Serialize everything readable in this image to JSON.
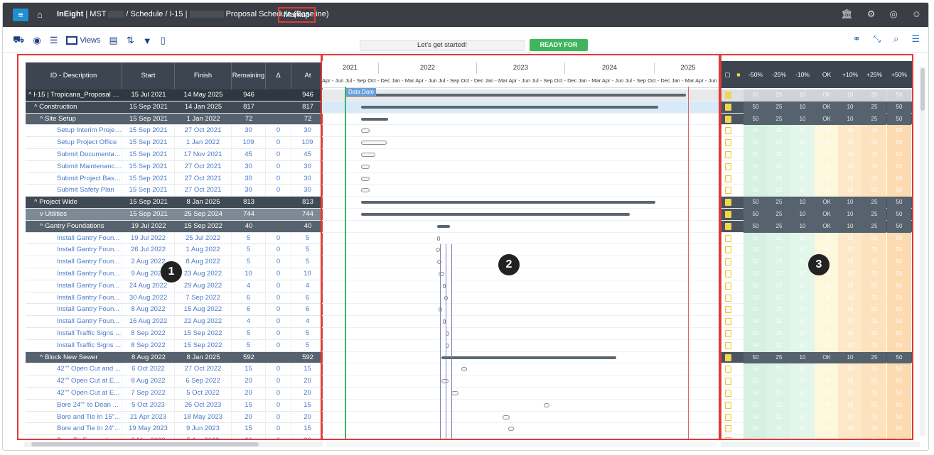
{
  "navbar": {
    "breadcrumb_app": "InEight",
    "breadcrumb_project": "MST",
    "breadcrumb_schedule": "Schedule",
    "breadcrumb_i15": "I-15",
    "breadcrumb_title": "Proposal Schedule (Baseline)",
    "markup_label": "Markup"
  },
  "toolbar": {
    "views_label": "Views",
    "lets_get_started": "Let's get started!",
    "ready_for_review": "READY FOR REVIEW?"
  },
  "grid": {
    "columns": [
      "ID - Description",
      "Start",
      "Finish",
      "Remaining ...",
      "Δ Rem...",
      "At Complet"
    ],
    "rows": [
      {
        "desc": "^ I-15 | Tropicana_Proposal Sch...",
        "start": "15 Jul 2021",
        "finish": "14 May 2025",
        "rem": "946",
        "drem": "",
        "atc": "946",
        "level": 0
      },
      {
        "desc": "^ Construction",
        "start": "15 Sep 2021",
        "finish": "14 Jan 2025",
        "rem": "817",
        "drem": "",
        "atc": "817",
        "level": 1
      },
      {
        "desc": "^ Site Setup",
        "start": "15 Sep 2021",
        "finish": "1 Jan 2022",
        "rem": "72",
        "drem": "",
        "atc": "72",
        "level": 2
      },
      {
        "desc": "Setup Interim Project ...",
        "start": "15 Sep 2021",
        "finish": "27 Oct 2021",
        "rem": "30",
        "drem": "0",
        "atc": "30",
        "level": 9
      },
      {
        "desc": "Setup Project Office",
        "start": "15 Sep 2021",
        "finish": "1 Jan 2022",
        "rem": "109",
        "drem": "0",
        "atc": "109",
        "level": 9
      },
      {
        "desc": "Submit Documentati...",
        "start": "15 Sep 2021",
        "finish": "17 Nov 2021",
        "rem": "45",
        "drem": "0",
        "atc": "45",
        "level": 9
      },
      {
        "desc": "Submit Maintenance ...",
        "start": "15 Sep 2021",
        "finish": "27 Oct 2021",
        "rem": "30",
        "drem": "0",
        "atc": "30",
        "level": 9
      },
      {
        "desc": "Submit Project Baseli...",
        "start": "15 Sep 2021",
        "finish": "27 Oct 2021",
        "rem": "30",
        "drem": "0",
        "atc": "30",
        "level": 9
      },
      {
        "desc": "Submit Safety Plan",
        "start": "15 Sep 2021",
        "finish": "27 Oct 2021",
        "rem": "30",
        "drem": "0",
        "atc": "30",
        "level": 9
      },
      {
        "desc": "^ Project Wide",
        "start": "15 Sep 2021",
        "finish": "8 Jan 2025",
        "rem": "813",
        "drem": "",
        "atc": "813",
        "level": 1
      },
      {
        "desc": "v Utilities",
        "start": "15 Sep 2021",
        "finish": "25 Sep 2024",
        "rem": "744",
        "drem": "",
        "atc": "744",
        "level": 3
      },
      {
        "desc": "^ Gantry Foundations",
        "start": "19 Jul 2022",
        "finish": "15 Sep 2022",
        "rem": "40",
        "drem": "",
        "atc": "40",
        "level": 2
      },
      {
        "desc": "Install Gantry Foun...",
        "start": "19 Jul 2022",
        "finish": "25 Jul 2022",
        "rem": "5",
        "drem": "0",
        "atc": "5",
        "level": 9
      },
      {
        "desc": "Install Gantry Foun...",
        "start": "26 Jul 2022",
        "finish": "1 Aug 2022",
        "rem": "5",
        "drem": "0",
        "atc": "5",
        "level": 9
      },
      {
        "desc": "Install Gantry Foun...",
        "start": "2 Aug 2022",
        "finish": "8 Aug 2022",
        "rem": "5",
        "drem": "0",
        "atc": "5",
        "level": 9
      },
      {
        "desc": "Install Gantry Foun...",
        "start": "9 Aug 2022",
        "finish": "23 Aug 2022",
        "rem": "10",
        "drem": "0",
        "atc": "10",
        "level": 9
      },
      {
        "desc": "Install Gantry Foun...",
        "start": "24 Aug 2022",
        "finish": "29 Aug 2022",
        "rem": "4",
        "drem": "0",
        "atc": "4",
        "level": 9
      },
      {
        "desc": "Install Gantry Foun...",
        "start": "30 Aug 2022",
        "finish": "7 Sep 2022",
        "rem": "6",
        "drem": "0",
        "atc": "6",
        "level": 9
      },
      {
        "desc": "Install Gantry Foun...",
        "start": "8 Aug 2022",
        "finish": "15 Aug 2022",
        "rem": "6",
        "drem": "0",
        "atc": "6",
        "level": 9
      },
      {
        "desc": "Install Gantry Foun...",
        "start": "16 Aug 2022",
        "finish": "22 Aug 2022",
        "rem": "4",
        "drem": "0",
        "atc": "4",
        "level": 9
      },
      {
        "desc": "Install Traffic Signs ...",
        "start": "8 Sep 2022",
        "finish": "15 Sep 2022",
        "rem": "5",
        "drem": "0",
        "atc": "5",
        "level": 9
      },
      {
        "desc": "Install Traffic Signs ...",
        "start": "8 Sep 2022",
        "finish": "15 Sep 2022",
        "rem": "5",
        "drem": "0",
        "atc": "5",
        "level": 9
      },
      {
        "desc": "^ Block New Sewer",
        "start": "8 Aug 2022",
        "finish": "8 Jan 2025",
        "rem": "592",
        "drem": "",
        "atc": "592",
        "level": 2
      },
      {
        "desc": "42\"\" Open Cut and ...",
        "start": "6 Oct 2022",
        "finish": "27 Oct 2022",
        "rem": "15",
        "drem": "0",
        "atc": "15",
        "level": 9
      },
      {
        "desc": "42\"\" Open Cut at E...",
        "start": "8 Aug 2022",
        "finish": "6 Sep 2022",
        "rem": "20",
        "drem": "0",
        "atc": "20",
        "level": 9
      },
      {
        "desc": "42\"\" Open Cut at E...",
        "start": "7 Sep 2022",
        "finish": "5 Oct 2022",
        "rem": "20",
        "drem": "0",
        "atc": "20",
        "level": 9
      },
      {
        "desc": "Bore 24\"\" to Dean ...",
        "start": "5 Oct 2023",
        "finish": "26 Oct 2023",
        "rem": "15",
        "drem": "0",
        "atc": "15",
        "level": 9
      },
      {
        "desc": "Bore and Tie In 15\"...",
        "start": "21 Apr 2023",
        "finish": "18 May 2023",
        "rem": "20",
        "drem": "0",
        "atc": "20",
        "level": 9
      },
      {
        "desc": "Bore and Tie In 24\"...",
        "start": "19 May 2023",
        "finish": "9 Jun 2023",
        "rem": "15",
        "drem": "0",
        "atc": "15",
        "level": 9
      },
      {
        "desc": "Bore Pit Excavation...",
        "start": "8 Mar 2023",
        "finish": "5 Apr 2023",
        "rem": "20",
        "drem": "0",
        "atc": "20",
        "level": 9
      }
    ]
  },
  "timeline": {
    "years": [
      "2021",
      "2022",
      "2023",
      "2024",
      "2025"
    ],
    "months_label": "Apr - Jun Jul - Sep Oct - Dec Jan - Mar Apr - Jun Jul - Sep Oct - Dec Jan - Mar Apr - Jun Jul - Sep Oct - Dec Jan - Mar Apr - Jun Jul - Sep Oct - Dec Jan - Mar Apr - Jun Jul - Se",
    "data_date_label": "Data Date"
  },
  "risk": {
    "headers": [
      "-50%",
      "-25%",
      "-10%",
      "OK",
      "+10%",
      "+25%",
      "+50%"
    ],
    "cell_values": [
      "50",
      "25",
      "10",
      "OK",
      "10",
      "25",
      "50"
    ]
  },
  "badges": [
    "1",
    "2",
    "3"
  ],
  "colors": {
    "accent": "#1e8fd0",
    "highlight_border": "#e03a3a",
    "ready_green": "#3fb65b",
    "navbar": "#3b3e44",
    "grid_header": "#3d4650"
  }
}
